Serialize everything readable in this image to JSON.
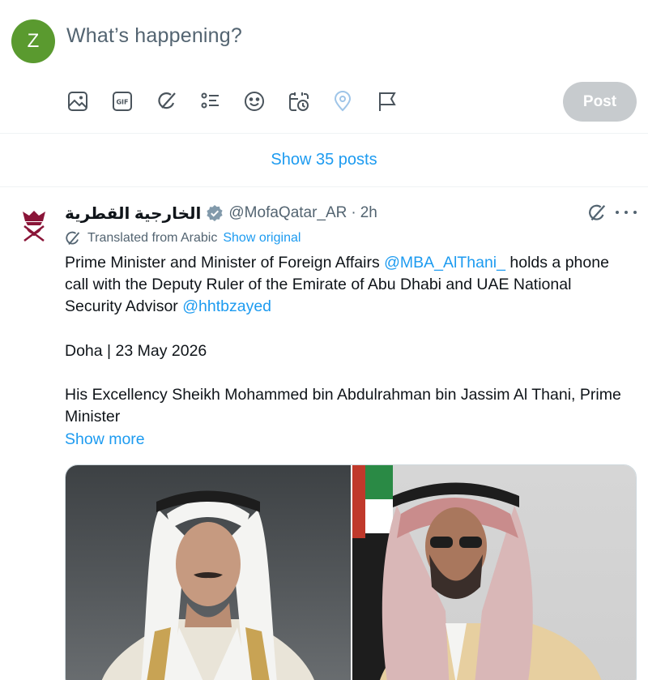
{
  "composer": {
    "avatar_letter": "Z",
    "placeholder": "What’s happening?",
    "tools": [
      "image-icon",
      "gif-icon",
      "grok-icon",
      "poll-icon",
      "emoji-icon",
      "schedule-icon",
      "location-icon",
      "flag-icon"
    ],
    "post_label": "Post"
  },
  "timeline": {
    "show_posts_label": "Show 35 posts"
  },
  "tweet": {
    "display_name": "الخارجية القطرية",
    "handle": "@MofaQatar_AR",
    "separator": "·",
    "time": "2h",
    "translated_label": "Translated from Arabic",
    "show_original_label": "Show original",
    "body": {
      "line1_pre": "Prime Minister and Minister of Foreign Affairs ",
      "mention1": "@MBA_AlThani_",
      "line1_post": " holds a phone call with the Deputy Ruler of the Emirate of Abu Dhabi and UAE National Security Advisor ",
      "mention2": "@hhtbzayed",
      "dateline": "Doha | 23 May 2026",
      "para3": "His Excellency Sheikh Mohammed bin Abdulrahman bin Jassim Al Thani, Prime Minister"
    },
    "show_more_label": "Show more",
    "colors": {
      "accent": "#1d9bf0",
      "secondary_text": "#536471",
      "verified": "#829aab",
      "post_disabled": "#c7cbce"
    }
  }
}
